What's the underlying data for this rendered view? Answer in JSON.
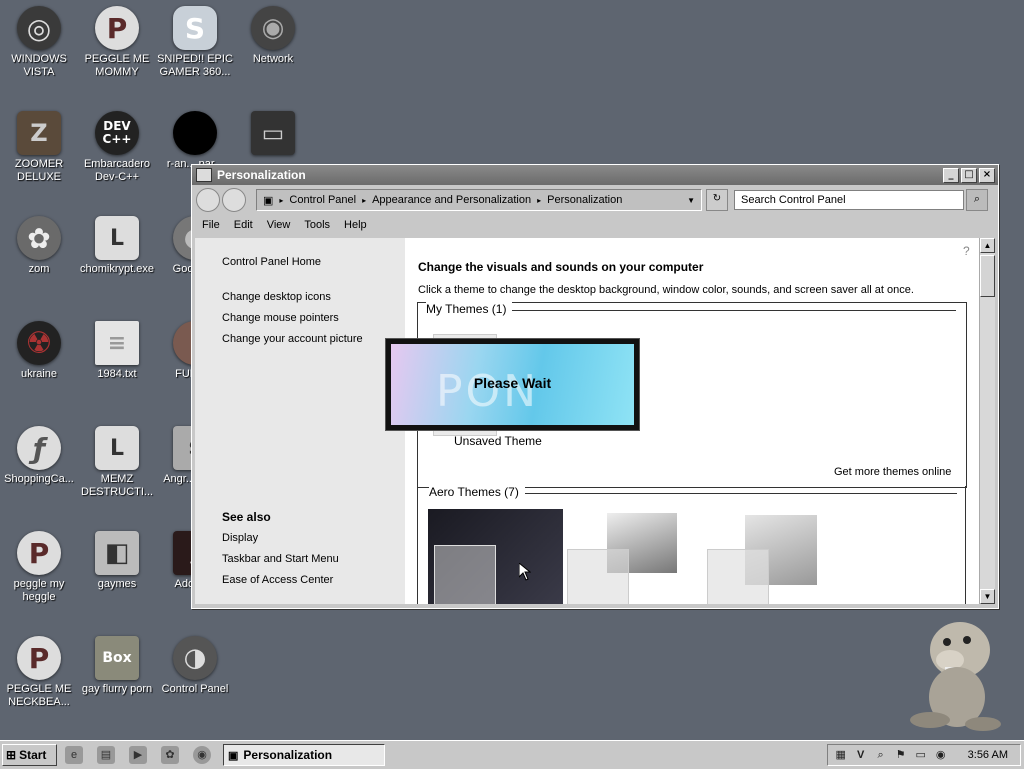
{
  "desktop": {
    "icons": [
      {
        "label": "WINDOWS VISTA",
        "glyph": "◎"
      },
      {
        "label": "PEGGLE ME MOMMY",
        "glyph": "P"
      },
      {
        "label": "SNIPED!! EPIC GAMER 360...",
        "glyph": "S"
      },
      {
        "label": "Network",
        "glyph": "◉"
      },
      {
        "label": "ZOOMER DELUXE",
        "glyph": "Z"
      },
      {
        "label": "Embarcadero Dev-C++",
        "glyph": "DEV C++"
      },
      {
        "label": "r-an... par...",
        "glyph": ""
      },
      {
        "label": "",
        "glyph": "▭"
      },
      {
        "label": "zom",
        "glyph": "✿"
      },
      {
        "label": "chomikrypt.exe",
        "glyph": "L"
      },
      {
        "label": "Google...",
        "glyph": "◐"
      },
      {
        "label": "ukraine",
        "glyph": "☢"
      },
      {
        "label": "1984.txt",
        "glyph": "≡"
      },
      {
        "label": "FURR...",
        "glyph": "●"
      },
      {
        "label": "ShoppingCa...",
        "glyph": "ƒ"
      },
      {
        "label": "MEMZ DESTRUCTI...",
        "glyph": "L"
      },
      {
        "label": "Angr... Sea...",
        "glyph": "S"
      },
      {
        "label": "peggle my heggle",
        "glyph": "P"
      },
      {
        "label": "gaymes",
        "glyph": "◧"
      },
      {
        "label": "Adobe...",
        "glyph": "/"
      },
      {
        "label": "PEGGLE ME NECKBEA...",
        "glyph": "P"
      },
      {
        "label": "gay flurry porn",
        "glyph": "Box"
      },
      {
        "label": "Control Panel",
        "glyph": "◑"
      }
    ]
  },
  "window": {
    "title": "Personalization",
    "controls": {
      "min": "_",
      "max": "□",
      "close": "×"
    },
    "breadcrumb": [
      "Control Panel",
      "Appearance and Personalization",
      "Personalization"
    ],
    "search_placeholder": "Search Control Panel",
    "menu": [
      "File",
      "Edit",
      "View",
      "Tools",
      "Help"
    ]
  },
  "left_pane": {
    "home": "Control Panel Home",
    "links": [
      "Change desktop icons",
      "Change mouse pointers",
      "Change your account picture"
    ],
    "see_also_title": "See also",
    "see_also": [
      "Display",
      "Taskbar and Start Menu",
      "Ease of Access Center"
    ]
  },
  "main": {
    "heading": "Change the visuals and sounds on your computer",
    "description": "Click a theme to change the desktop background, window color, sounds, and screen saver all at once.",
    "my_themes_title": "My Themes (1)",
    "unsaved_theme": "Unsaved Theme",
    "get_more": "Get more themes online",
    "aero_title": "Aero Themes (7)"
  },
  "dialog": {
    "text": "Please Wait",
    "background_word": "PON"
  },
  "taskbar": {
    "start": "Start",
    "active_task": "Personalization",
    "clock": "3:56 AM"
  }
}
